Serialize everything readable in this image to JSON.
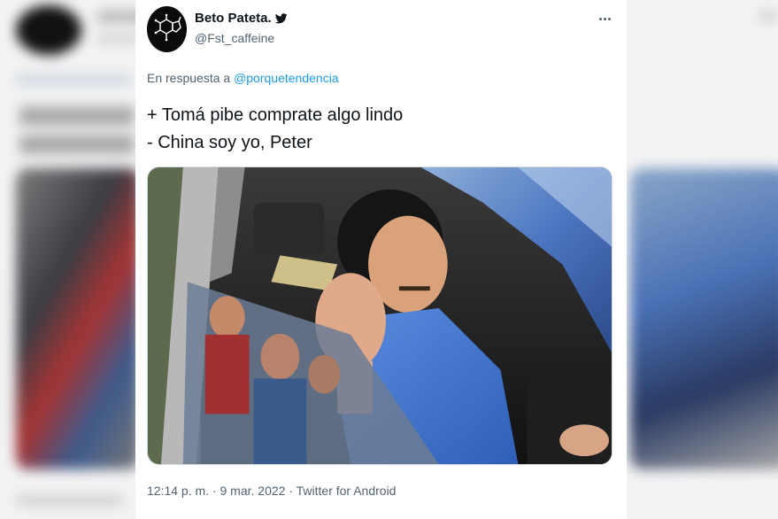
{
  "tweet": {
    "display_name": "Beto Pateta.",
    "handle": "@Fst_caffeine",
    "reply_prefix": "En respuesta a",
    "reply_mention": "@porquetendencia",
    "text_lines": [
      "+ Tomá pibe comprate algo lindo",
      "- China soy yo, Peter"
    ],
    "time": "12:14 p. m.",
    "separator1": " · ",
    "date": "9 mar. 2022",
    "separator2": " · ",
    "source": "Twitter for Android"
  },
  "icons": {
    "avatar": "caffeine-molecule-icon",
    "verified_mark": "twitter-bird-icon",
    "more": "more-dots-icon"
  },
  "colors": {
    "link": "#1d9bf0",
    "secondary_text": "#536471",
    "primary_text": "#0f1419"
  }
}
